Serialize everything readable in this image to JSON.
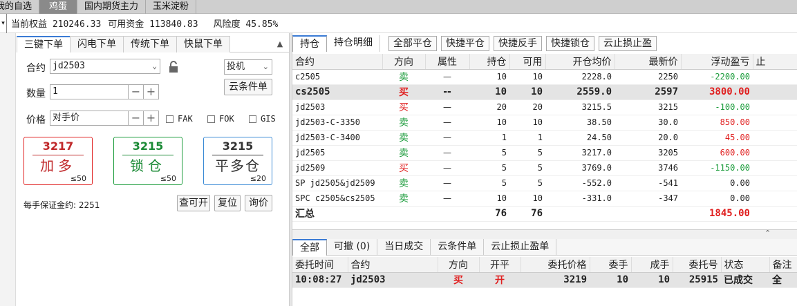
{
  "top_tabs": [
    {
      "label": "我的自选",
      "active": false
    },
    {
      "label": "鸡蛋",
      "active": true
    },
    {
      "label": "国内期货主力",
      "active": false
    },
    {
      "label": "玉米淀粉",
      "active": false
    }
  ],
  "account": {
    "equity": "当前权益 210246.33",
    "available": "可用资金 113840.83",
    "risk": "风险度 45.85%"
  },
  "order_panel": {
    "tabs": [
      "三键下单",
      "闪电下单",
      "传统下单",
      "快鼠下单"
    ],
    "contract_label": "合约",
    "contract_value": "jd2503",
    "hedge_value": "投机",
    "cloud_order_label": "云条件单",
    "quantity_label": "数量",
    "quantity_value": "1",
    "price_label": "价格",
    "price_value": "对手价",
    "fak": "FAK",
    "fok": "FOK",
    "gis": "GIS",
    "buttons": [
      {
        "price": "3217",
        "action": "加多",
        "limit": "≤50",
        "color": "#e02020"
      },
      {
        "price": "3215",
        "action": "锁仓",
        "limit": "≤50",
        "color": "#1a9b3a"
      },
      {
        "price": "3215",
        "action": "平多仓",
        "limit": "≤20",
        "color": "#333333"
      }
    ],
    "margin_text": "每手保证金约: 2251",
    "check_open": "查可开",
    "reset": "复位",
    "inquiry": "询价"
  },
  "positions": {
    "tabs": [
      "持仓",
      "持仓明细"
    ],
    "actions": [
      "全部平仓",
      "快捷平仓",
      "快捷反手",
      "快捷锁仓",
      "云止损止盈"
    ],
    "headers": [
      "合约",
      "方向",
      "属性",
      "持仓",
      "可用",
      "开仓均价",
      "最新价",
      "浮动盈亏",
      "止"
    ],
    "rows": [
      {
        "contract": "c2505",
        "dir": "卖",
        "attr": "—",
        "pos": "10",
        "avail": "10",
        "open": "2228.0",
        "last": "2250",
        "pnl": "-2200.00",
        "sel": false
      },
      {
        "contract": "cs2505",
        "dir": "买",
        "attr": "--",
        "pos": "10",
        "avail": "10",
        "open": "2559.0",
        "last": "2597",
        "pnl": "3800.00",
        "sel": true
      },
      {
        "contract": "jd2503",
        "dir": "买",
        "attr": "—",
        "pos": "20",
        "avail": "20",
        "open": "3215.5",
        "last": "3215",
        "pnl": "-100.00",
        "sel": false
      },
      {
        "contract": "jd2503-C-3350",
        "dir": "卖",
        "attr": "—",
        "pos": "10",
        "avail": "10",
        "open": "38.50",
        "last": "30.0",
        "pnl": "850.00",
        "sel": false
      },
      {
        "contract": "jd2503-C-3400",
        "dir": "卖",
        "attr": "—",
        "pos": "1",
        "avail": "1",
        "open": "24.50",
        "last": "20.0",
        "pnl": "45.00",
        "sel": false
      },
      {
        "contract": "jd2505",
        "dir": "卖",
        "attr": "—",
        "pos": "5",
        "avail": "5",
        "open": "3217.0",
        "last": "3205",
        "pnl": "600.00",
        "sel": false
      },
      {
        "contract": "jd2509",
        "dir": "买",
        "attr": "—",
        "pos": "5",
        "avail": "5",
        "open": "3769.0",
        "last": "3746",
        "pnl": "-1150.00",
        "sel": false
      },
      {
        "contract": "SP jd2505&jd2509",
        "dir": "卖",
        "attr": "—",
        "pos": "5",
        "avail": "5",
        "open": "-552.0",
        "last": "-541",
        "pnl": "0.00",
        "sel": false
      },
      {
        "contract": "SPC c2505&cs2505",
        "dir": "卖",
        "attr": "—",
        "pos": "10",
        "avail": "10",
        "open": "-331.0",
        "last": "-347",
        "pnl": "0.00",
        "sel": false
      }
    ],
    "total": {
      "label": "汇总",
      "pos": "76",
      "avail": "76",
      "pnl": "1845.00"
    }
  },
  "orders": {
    "tabs": [
      "全部",
      "可撤 (0)",
      "当日成交",
      "云条件单",
      "云止损止盈单"
    ],
    "headers": [
      "委托时间",
      "合约",
      "方向",
      "开平",
      "委托价格",
      "委手",
      "成手",
      "委托号",
      "状态",
      "备注"
    ],
    "rows": [
      {
        "time": "10:08:27",
        "contract": "jd2503",
        "dir": "买",
        "oc": "开",
        "price": "3219",
        "qty": "10",
        "filled": "10",
        "id": "25915",
        "status": "已成交",
        "note": "全"
      }
    ]
  }
}
